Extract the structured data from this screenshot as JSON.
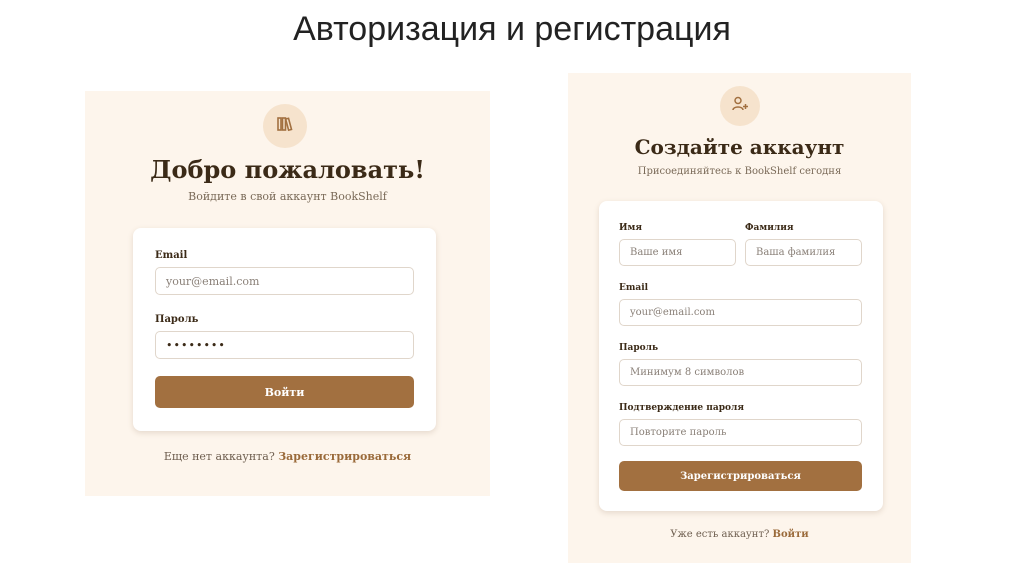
{
  "slide": {
    "title": "Авторизация и регистрация"
  },
  "login": {
    "logo_icon": "books-icon",
    "heading": "Добро пожаловать!",
    "subheading": "Войдите в свой аккаунт BookShelf",
    "email_label": "Email",
    "email_placeholder": "your@email.com",
    "password_label": "Пароль",
    "password_value": "••••••••",
    "submit_label": "Войти",
    "footer_text": "Еще нет аккаунта?",
    "footer_link": "Зарегистрироваться"
  },
  "register": {
    "logo_icon": "user-plus-icon",
    "heading": "Создайте аккаунт",
    "subheading": "Присоединяйтесь к BookShelf сегодня",
    "first_name_label": "Имя",
    "first_name_placeholder": "Ваше имя",
    "last_name_label": "Фамилия",
    "last_name_placeholder": "Ваша фамилия",
    "email_label": "Email",
    "email_placeholder": "your@email.com",
    "password_label": "Пароль",
    "password_placeholder": "Минимум 8 символов",
    "confirm_label": "Подтверждение пароля",
    "confirm_placeholder": "Повторите пароль",
    "submit_label": "Зарегистрироваться",
    "footer_text": "Уже есть аккаунт?",
    "footer_link": "Войти"
  },
  "colors": {
    "panel_bg": "#fdf5ec",
    "accent": "#a27040",
    "icon_circle": "#f6e3cd",
    "heading": "#3b2a17"
  }
}
